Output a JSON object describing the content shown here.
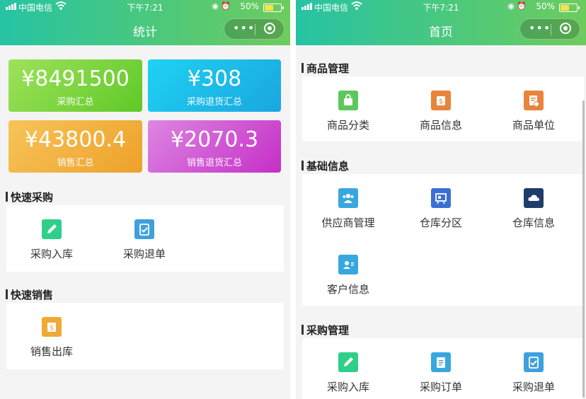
{
  "status_bar": {
    "carrier": "中国电信",
    "time": "下午7:21",
    "battery": "50%"
  },
  "left": {
    "title": "统计",
    "summary": [
      {
        "amount": "¥8491500",
        "label": "采购汇总"
      },
      {
        "amount": "¥308",
        "label": "采购退货汇总"
      },
      {
        "amount": "¥43800.4",
        "label": "销售汇总"
      },
      {
        "amount": "¥2070.3",
        "label": "销售退货汇总"
      }
    ],
    "sections": [
      {
        "title": "快速采购",
        "items": [
          {
            "label": "采购入库",
            "icon": "pencil-icon"
          },
          {
            "label": "采购退单",
            "icon": "clipboard-check-icon"
          }
        ]
      },
      {
        "title": "快速销售",
        "items": [
          {
            "label": "销售出库",
            "icon": "dollar-bag-icon"
          }
        ]
      }
    ]
  },
  "right": {
    "title": "首页",
    "sections": [
      {
        "title": "商品管理",
        "items": [
          {
            "label": "商品分类",
            "icon": "shopping-bag-icon"
          },
          {
            "label": "商品信息",
            "icon": "dollar-bag-icon"
          },
          {
            "label": "商品单位",
            "icon": "document-icon"
          }
        ]
      },
      {
        "title": "基础信息",
        "items": [
          {
            "label": "供应商管理",
            "icon": "people-icon"
          },
          {
            "label": "仓库分区",
            "icon": "board-icon"
          },
          {
            "label": "仓库信息",
            "icon": "cloud-icon"
          },
          {
            "label": "客户信息",
            "icon": "contact-icon"
          }
        ]
      },
      {
        "title": "采购管理",
        "items": [
          {
            "label": "采购入库",
            "icon": "pencil-icon"
          },
          {
            "label": "采购订单",
            "icon": "clipboard-icon"
          },
          {
            "label": "采购退单",
            "icon": "clipboard-check-icon"
          }
        ]
      }
    ]
  },
  "colors": {
    "nav_gradient": [
      "#26c3a3",
      "#6dcc5c"
    ],
    "card_green": [
      "#9ee25b",
      "#5fc927"
    ],
    "card_blue": [
      "#1fd2f2",
      "#1aa6e0"
    ],
    "card_orange": [
      "#f7c45a",
      "#eda12a"
    ],
    "card_purple": [
      "#dc86e2",
      "#c62fc7"
    ]
  }
}
